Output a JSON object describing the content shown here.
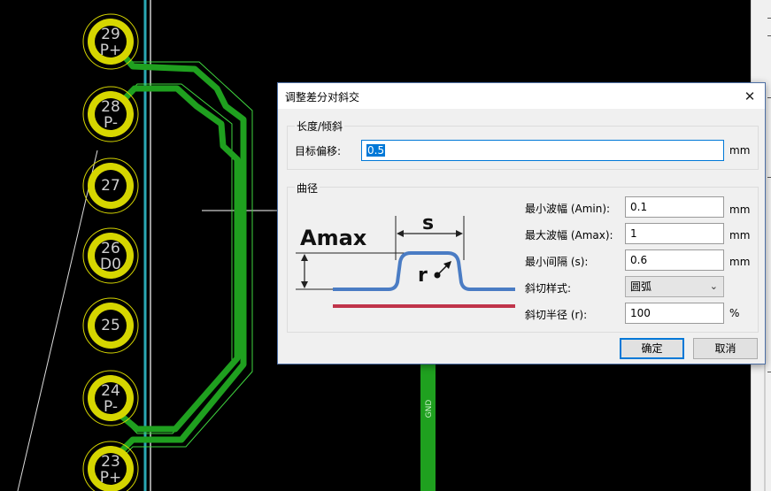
{
  "pcb": {
    "pads": [
      {
        "number": "29",
        "net": "P+"
      },
      {
        "number": "28",
        "net": "P-"
      },
      {
        "number": "27",
        "net": ""
      },
      {
        "number": "26",
        "net": "D0"
      },
      {
        "number": "25",
        "net": ""
      },
      {
        "number": "24",
        "net": "P-"
      },
      {
        "number": "23",
        "net": "P+"
      }
    ],
    "gnd_label": "GND",
    "colors": {
      "pad_ring": "#d6d600",
      "track": "#1fa01f",
      "outline": "#3fd63f",
      "board_edge": "#2aa8b5"
    }
  },
  "dialog": {
    "title": "调整差分对斜交",
    "close": "✕",
    "length_group": {
      "label": "长度/倾斜",
      "target_offset_label": "目标偏移:",
      "target_offset_value": "0.5",
      "unit": "mm"
    },
    "meander_group": {
      "label": "曲径",
      "diagram": {
        "amax": "Amax",
        "s": "s",
        "r": "r"
      },
      "min_amp_label": "最小波幅 (Amin):",
      "min_amp_value": "0.1",
      "min_amp_unit": "mm",
      "max_amp_label": "最大波幅 (Amax):",
      "max_amp_value": "1",
      "max_amp_unit": "mm",
      "min_spacing_label": "最小间隔 (s):",
      "min_spacing_value": "0.6",
      "min_spacing_unit": "mm",
      "corner_style_label": "斜切样式:",
      "corner_style_value": "圆弧",
      "corner_radius_label": "斜切半径 (r):",
      "corner_radius_value": "100",
      "corner_radius_unit": "%"
    },
    "ok_label": "确定",
    "cancel_label": "取消"
  }
}
